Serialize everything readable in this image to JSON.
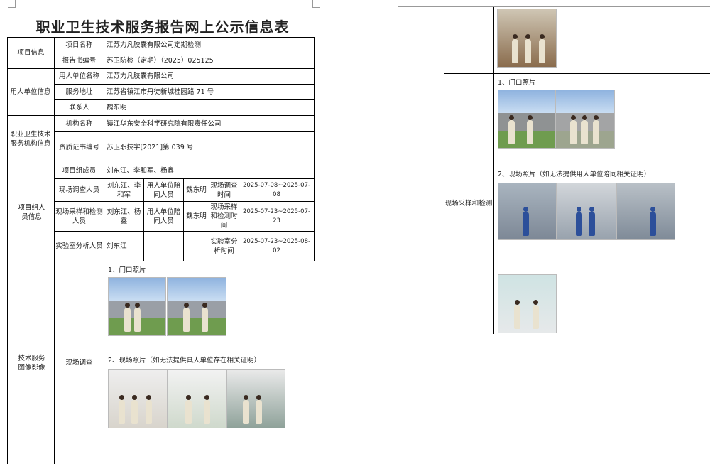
{
  "title": "职业卫生技术服务报告网上公示信息表",
  "sections": {
    "project_info": "项目信息",
    "employer_info": "用人单位信息",
    "agency_info": "职业卫生技术服务机构信息",
    "team_info": "项目组人员信息",
    "images": "技术服务图像影像"
  },
  "rows": {
    "project_name_label": "项目名称",
    "project_name": "江苏力凡胶囊有限公司定期检测",
    "report_no_label": "报告书编号",
    "report_no": "苏卫防检（定期）（2025）025125",
    "employer_name_label": "用人单位名称",
    "employer_name": "江苏力凡胶囊有限公司",
    "service_addr_label": "服务地址",
    "service_addr": "江苏省镇江市丹徒新城桂园路 71 号",
    "contact_label": "联系人",
    "contact": "魏东明",
    "agency_name_label": "机构名称",
    "agency_name": "镇江华东安全科学研究院有限责任公司",
    "cert_label": "资质证书编号",
    "cert": "苏卫职技字[2021]第 039 号",
    "team_label": "项目组成员",
    "team": "刘东江、李和军、杨鑫",
    "survey_label": "现场调查人员",
    "survey_people": "刘东江、李和军",
    "employer_staff": "用人单位陪同人员",
    "employer_staff_val": "魏东明",
    "survey_time_label": "现场调查时间",
    "survey_time": "2025-07-08~2025-07-08",
    "sampling_label": "现场采样和检测人员",
    "sampling_people": "刘东江、杨鑫",
    "sampling_time_label": "现场采样和检测时间",
    "sampling_time": "2025-07-23~2025-07-23",
    "lab_label": "实验室分析人员",
    "lab_people": "刘东江",
    "lab_time_label": "实验室分析时间",
    "lab_time": "2025-07-23~2025-08-02"
  },
  "images": {
    "survey_label": "现场调查",
    "survey_caption1": "1、门口照片",
    "survey_caption2": "2、现场照片（如无法提供具人单位存在相关证明）",
    "sampling_label": "现场采样和检测",
    "sampling_caption1": "1、门口照片",
    "sampling_caption2": "2、现场照片（如无法提供用人单位陪同相关证明）"
  }
}
